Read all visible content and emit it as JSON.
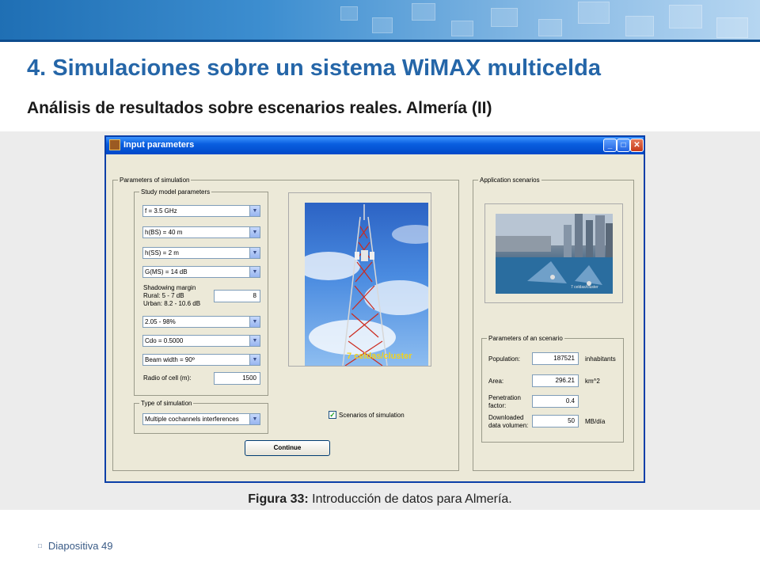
{
  "slide": {
    "title": "4. Simulaciones sobre un sistema WiMAX multicelda",
    "subtitle": "Análisis de resultados sobre escenarios reales. Almería (II)",
    "caption_bold": "Figura 33:",
    "caption_text": " Introducción de datos para Almería.",
    "footer": "Diapositiva 49"
  },
  "dialog": {
    "title": "Input parameters",
    "window_buttons": {
      "minimize": "_",
      "maximize": "□",
      "close": "✕"
    },
    "params_group": "Parameters of simulation",
    "study_group": "Study model parameters",
    "f": "f = 3.5 GHz",
    "hbs": "h(BS) = 40 m",
    "hss": "h(SS) = 2 m",
    "gms": "G(MS) = 14 dB",
    "shadow_title": "Shadowing margin",
    "shadow_rural": "Rural:  5 - 7 dB",
    "shadow_urban": "Urban: 8.2 - 10.6 dB",
    "shadow_value": "8",
    "coverage": "2.05 - 98%",
    "cdo": "Cdo = 0.5000",
    "beam": "Beam width = 90º",
    "radio_label": "Radio of cell (m):",
    "radio_value": "1500",
    "type_group": "Type of simulation",
    "type_value": "Multiple cochannels interferences",
    "image_overlay": "7 celdas/cluster",
    "scenarios_check": "Scenarios of simulation",
    "continue": "Continue",
    "app_group": "Application scenarios",
    "city_overlay": "7 celdas/cluster",
    "scenario_group": "Parameters of an scenario",
    "population_label": "Population:",
    "population_value": "187521",
    "population_unit": "inhabitants",
    "area_label": "Area:",
    "area_value": "296.21",
    "area_unit": "km^2",
    "penetration_label": "Penetration factor:",
    "penetration_value": "0.4",
    "download_label": "Downloaded data volumen:",
    "download_value": "50",
    "download_unit": "MB/día"
  },
  "colors": {
    "title": "#2566a8",
    "titlebar": "#0a5fe0",
    "dialog_bg": "#ece9d8"
  }
}
